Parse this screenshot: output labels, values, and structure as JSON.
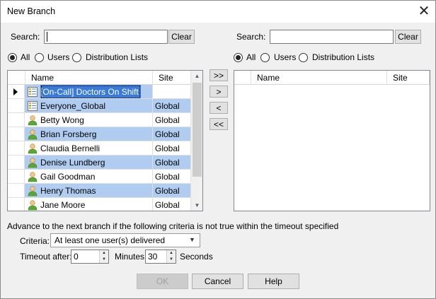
{
  "window": {
    "title": "New Branch",
    "close_glyph": "✕"
  },
  "left": {
    "search_label": "Search:",
    "search_value": "",
    "clear_label": "Clear",
    "filters": [
      {
        "label": "All",
        "selected": true
      },
      {
        "label": "Users",
        "selected": false
      },
      {
        "label": "Distribution Lists",
        "selected": false
      }
    ],
    "columns": [
      "Name",
      "Site"
    ],
    "rows": [
      {
        "name": "[On-Call] Doctors On Shift",
        "site": "",
        "icon": "distribution-list-icon",
        "selected": true,
        "current": true
      },
      {
        "name": "Everyone_Global",
        "site": "Global",
        "icon": "distribution-list-icon",
        "selected": true
      },
      {
        "name": "Betty Wong",
        "site": "Global",
        "icon": "user-icon",
        "selected": false
      },
      {
        "name": "Brian Forsberg",
        "site": "Global",
        "icon": "user-icon",
        "selected": true
      },
      {
        "name": "Claudia Bernelli",
        "site": "Global",
        "icon": "user-icon",
        "selected": false
      },
      {
        "name": "Denise Lundberg",
        "site": "Global",
        "icon": "user-icon",
        "selected": true
      },
      {
        "name": "Gail Goodman",
        "site": "Global",
        "icon": "user-icon",
        "selected": false
      },
      {
        "name": "Henry Thomas",
        "site": "Global",
        "icon": "user-icon",
        "selected": true
      },
      {
        "name": "Jane Moore",
        "site": "Global",
        "icon": "user-icon",
        "selected": false
      }
    ]
  },
  "transfer": {
    "add_all": ">>",
    "add": ">",
    "remove": "<",
    "remove_all": "<<"
  },
  "right": {
    "search_label": "Search:",
    "search_value": "",
    "clear_label": "Clear",
    "filters": [
      {
        "label": "All",
        "selected": true
      },
      {
        "label": "Users",
        "selected": false
      },
      {
        "label": "Distribution Lists",
        "selected": false
      }
    ],
    "columns": [
      "Name",
      "Site"
    ]
  },
  "criteria": {
    "instruction": "Advance to the next branch if the following criteria is not true within the timeout specified",
    "criteria_label": "Criteria:",
    "criteria_value": "At least one user(s) delivered",
    "timeout_label": "Timeout after:",
    "timeout_value": "0",
    "minutes_label": "Minutes",
    "seconds_value": "30",
    "seconds_label": "Seconds"
  },
  "buttons": {
    "ok": "OK",
    "cancel": "Cancel",
    "help": "Help"
  },
  "colors": {
    "selection": "#b0cdf1",
    "accent": "#0078d7",
    "user_green": "#5aa832"
  }
}
